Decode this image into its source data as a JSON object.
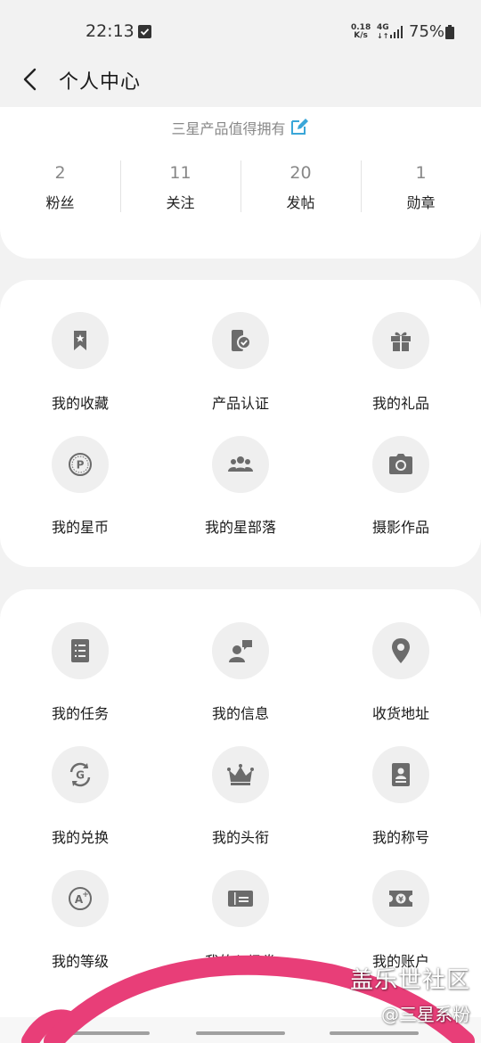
{
  "status_bar": {
    "time": "22:13",
    "net_speed_value": "0.18",
    "net_speed_unit": "K/s",
    "network_type": "4G",
    "battery": "75%"
  },
  "header": {
    "back_icon": "chevron-left-icon",
    "title": "个人中心"
  },
  "profile": {
    "signature": "三星产品值得拥有",
    "edit_icon": "edit-icon",
    "stats": [
      {
        "value": "2",
        "label": "粉丝"
      },
      {
        "value": "11",
        "label": "关注"
      },
      {
        "value": "20",
        "label": "发帖"
      },
      {
        "value": "1",
        "label": "勋章"
      }
    ]
  },
  "grid1": [
    {
      "label": "我的收藏",
      "icon": "bookmark-star-icon"
    },
    {
      "label": "产品认证",
      "icon": "phone-verified-icon"
    },
    {
      "label": "我的礼品",
      "icon": "gift-icon"
    },
    {
      "label": "我的星币",
      "icon": "coin-p-icon"
    },
    {
      "label": "我的星部落",
      "icon": "group-icon"
    },
    {
      "label": "摄影作品",
      "icon": "camera-icon"
    }
  ],
  "grid2": [
    {
      "label": "我的任务",
      "icon": "task-list-icon"
    },
    {
      "label": "我的信息",
      "icon": "message-user-icon"
    },
    {
      "label": "收货地址",
      "icon": "location-pin-icon"
    },
    {
      "label": "我的兑换",
      "icon": "exchange-g-icon"
    },
    {
      "label": "我的头衔",
      "icon": "crown-icon"
    },
    {
      "label": "我的称号",
      "icon": "badge-card-icon"
    },
    {
      "label": "我的等级",
      "icon": "level-a-plus-icon"
    },
    {
      "label": "我的入场券",
      "icon": "ticket-icon"
    },
    {
      "label": "我的账户",
      "icon": "wallet-yen-icon"
    }
  ],
  "watermark": {
    "line1": "盖乐世社区",
    "line2": "@三星系粉"
  },
  "colors": {
    "background": "#f2f2f2",
    "card": "#ffffff",
    "icon": "#6b6b6b",
    "icon_circle": "#efefef",
    "accent_edit": "#3aa6d8",
    "swoosh": "#e83e78"
  }
}
